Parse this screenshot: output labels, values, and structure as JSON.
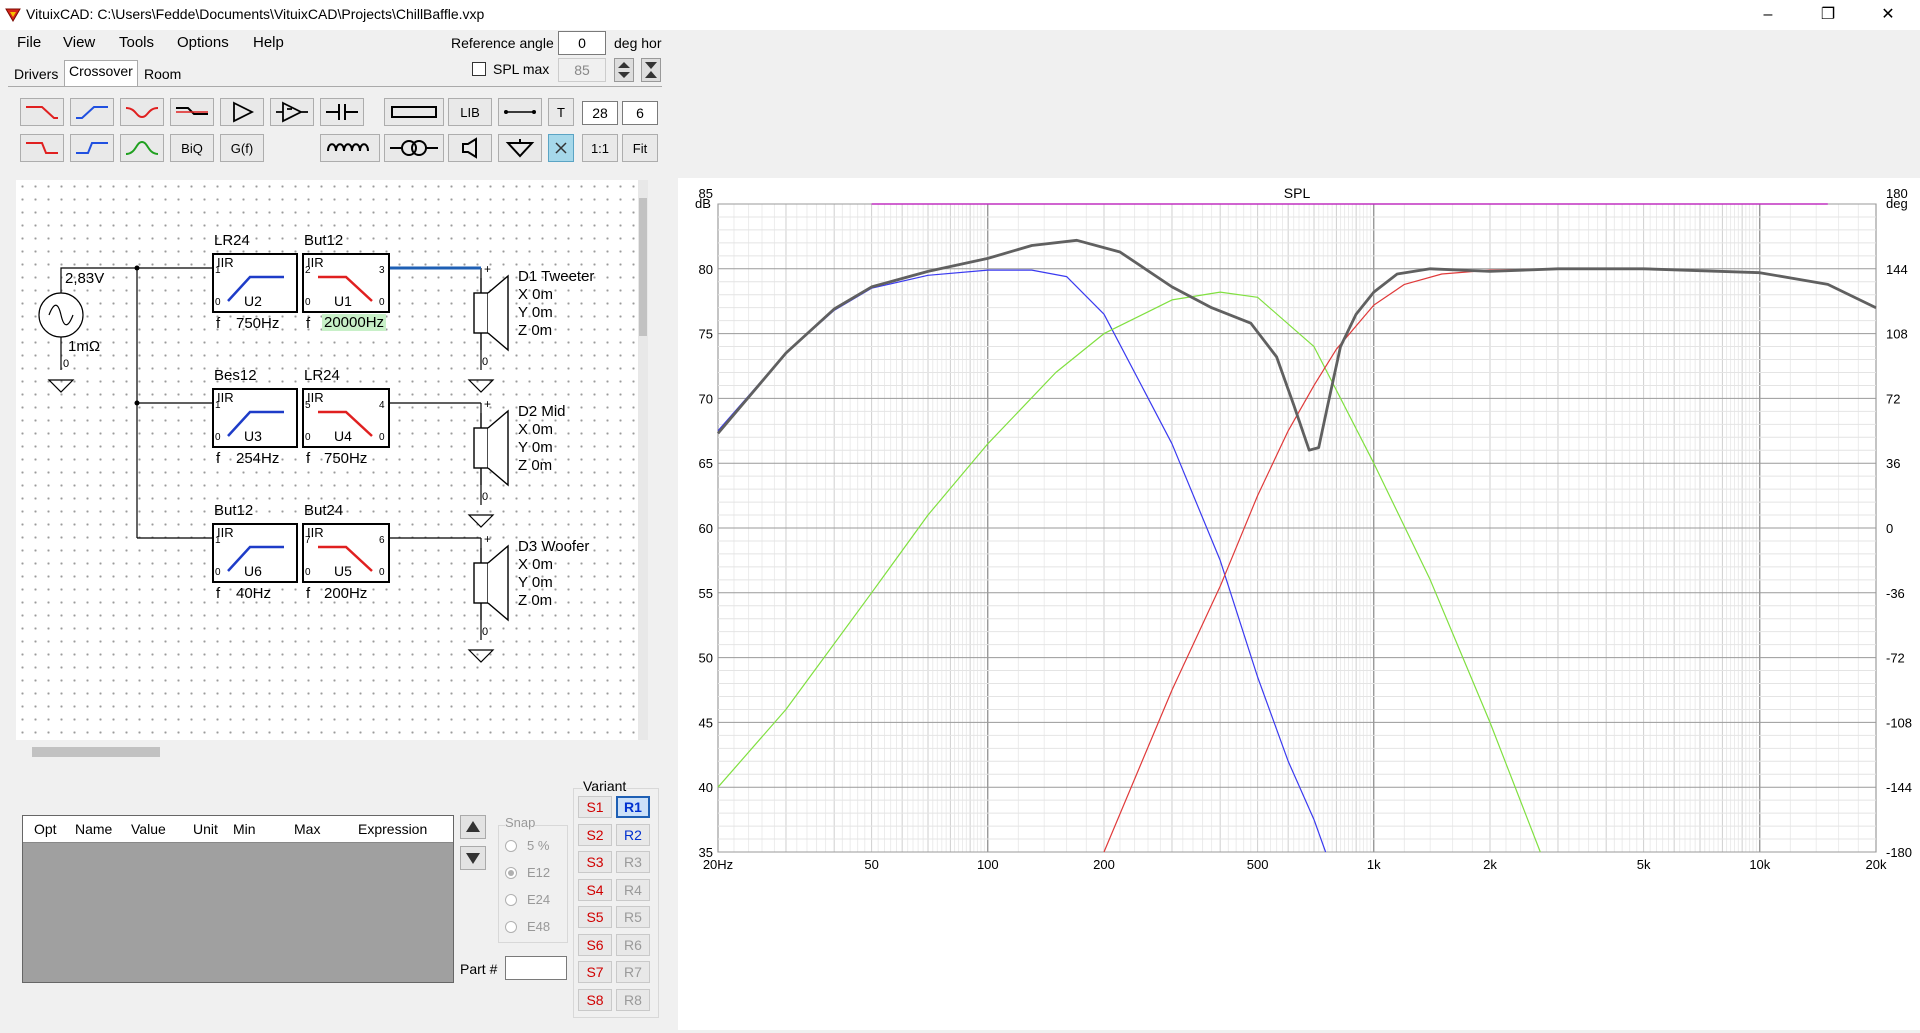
{
  "titlebar": {
    "title": "VituixCAD: C:\\Users\\Fedde\\Documents\\VituixCAD\\Projects\\ChillBaffle.vxp",
    "minimize": "–",
    "restore": "❐",
    "close": "✕"
  },
  "menu": [
    {
      "label": "File"
    },
    {
      "label": "View"
    },
    {
      "label": "Tools"
    },
    {
      "label": "Options"
    },
    {
      "label": "Help"
    }
  ],
  "reference": {
    "label": "Reference angle",
    "value": "0",
    "unit": "deg hor"
  },
  "splmax": {
    "label": "SPL max",
    "value": "85",
    "checked": false
  },
  "tabs": [
    {
      "label": "Drivers"
    },
    {
      "label": "Crossover"
    },
    {
      "label": "Room"
    }
  ],
  "toolbar": {
    "lib": "LIB",
    "t": "T",
    "one_to_one": "1:1",
    "fit": "Fit",
    "biq": "BiQ",
    "gf": "G(f)",
    "value1": "28",
    "value2": "6"
  },
  "schematic": {
    "source": {
      "voltage": "2,83V",
      "resistance": "1mΩ",
      "node": "0"
    },
    "blocks": [
      {
        "id": "U2",
        "type": "LR24",
        "kind": "IIR",
        "freq": "750Hz",
        "in": "1",
        "gnd": "0"
      },
      {
        "id": "U1",
        "type": "But12",
        "kind": "IIR",
        "freq": "20000Hz",
        "in": "2",
        "out": "3",
        "gnd": "0",
        "highlight": true
      },
      {
        "id": "U3",
        "type": "Bes12",
        "kind": "IIR",
        "freq": "254Hz",
        "in": "1",
        "gnd": "0"
      },
      {
        "id": "U4",
        "type": "LR24",
        "kind": "IIR",
        "freq": "750Hz",
        "in": "5",
        "out": "4",
        "gnd": "0"
      },
      {
        "id": "U6",
        "type": "But12",
        "kind": "IIR",
        "freq": "40Hz",
        "in": "1",
        "gnd": "0"
      },
      {
        "id": "U5",
        "type": "But24",
        "kind": "IIR",
        "freq": "200Hz",
        "in": "7",
        "out": "6",
        "gnd": "0"
      }
    ],
    "drivers": [
      {
        "name": "D1 Tweeter",
        "x": "X 0m",
        "y": "Y 0m",
        "z": "Z 0m",
        "plus": "+",
        "gnd": "0"
      },
      {
        "name": "D2 Mid",
        "x": "X 0m",
        "y": "Y 0m",
        "z": "Z 0m",
        "plus": "+",
        "gnd": "0"
      },
      {
        "name": "D3 Woofer",
        "x": "X 0m",
        "y": "Y 0m",
        "z": "Z 0m",
        "plus": "+",
        "gnd": "0"
      }
    ],
    "f_prefix": "f"
  },
  "table": {
    "columns": [
      "Opt",
      "Name",
      "Value",
      "Unit",
      "Min",
      "Max",
      "Expression"
    ]
  },
  "snap": {
    "title": "Snap",
    "options": [
      {
        "label": "5 %",
        "checked": false
      },
      {
        "label": "E12",
        "checked": true
      },
      {
        "label": "E24",
        "checked": false
      },
      {
        "label": "E48",
        "checked": false
      }
    ]
  },
  "partno": {
    "label": "Part #",
    "value": ""
  },
  "variant": {
    "title": "Variant",
    "s": [
      "S1",
      "S2",
      "S3",
      "S4",
      "S5",
      "S6",
      "S7",
      "S8"
    ],
    "r": [
      "R1",
      "R2",
      "R3",
      "R4",
      "R5",
      "R6",
      "R7",
      "R8"
    ],
    "selected": "R1"
  },
  "colors": {
    "accent": "#1e5fb4",
    "tweeter": "#e03a3a",
    "mid": "#80e040",
    "woofer": "#3a3af0",
    "sum": "#606060",
    "max": "#c030c0"
  },
  "chart_data": {
    "type": "line",
    "title": "SPL",
    "xscale": "log",
    "xlim": [
      20,
      20000
    ],
    "ylim": [
      35,
      85
    ],
    "y2lim": [
      -180,
      180
    ],
    "ylabel": "dB",
    "y2label": "deg",
    "xticks": [
      {
        "v": 20,
        "t": "20Hz"
      },
      {
        "v": 50,
        "t": "50"
      },
      {
        "v": 100,
        "t": "100"
      },
      {
        "v": 200,
        "t": "200"
      },
      {
        "v": 500,
        "t": "500"
      },
      {
        "v": 1000,
        "t": "1k"
      },
      {
        "v": 2000,
        "t": "2k"
      },
      {
        "v": 5000,
        "t": "5k"
      },
      {
        "v": 10000,
        "t": "10k"
      },
      {
        "v": 20000,
        "t": "20k"
      }
    ],
    "yticks": [
      35,
      40,
      45,
      50,
      55,
      60,
      65,
      70,
      75,
      80,
      85
    ],
    "y2ticks": [
      -180,
      -144,
      -108,
      -72,
      -36,
      0,
      36,
      72,
      108,
      144,
      180
    ],
    "grid": true,
    "series": [
      {
        "color": "#c030c0",
        "width": 1.5,
        "x": [
          50,
          15000
        ],
        "y": [
          85,
          85
        ]
      },
      {
        "color": "#3a3af0",
        "width": 1.2,
        "x": [
          20,
          30,
          40,
          50,
          70,
          100,
          130,
          160,
          200,
          250,
          300,
          400,
          500,
          600,
          700,
          750
        ],
        "y": [
          67.5,
          73.5,
          76.8,
          78.5,
          79.5,
          79.9,
          79.9,
          79.4,
          76.5,
          71,
          66.5,
          57.5,
          48.5,
          42,
          37.5,
          35
        ]
      },
      {
        "color": "#80e040",
        "width": 1.2,
        "x": [
          20,
          30,
          50,
          70,
          100,
          150,
          200,
          300,
          400,
          500,
          700,
          1000,
          1400,
          2000,
          2700
        ],
        "y": [
          40,
          46,
          55,
          61,
          66.5,
          72,
          75,
          77.6,
          78.2,
          77.8,
          74,
          65,
          56,
          45,
          35
        ]
      },
      {
        "color": "#e03a3a",
        "width": 1.2,
        "x": [
          200,
          300,
          400,
          500,
          600,
          700,
          800,
          1000,
          1200,
          1500,
          2000,
          3000,
          5000,
          10000,
          15000,
          20000
        ],
        "y": [
          35,
          47.5,
          55.5,
          62.5,
          67.5,
          71,
          73.8,
          77.2,
          78.8,
          79.6,
          79.9,
          80,
          80,
          79.7,
          78.8,
          77
        ]
      },
      {
        "color": "#606060",
        "width": 2.8,
        "x": [
          20,
          30,
          40,
          50,
          70,
          100,
          130,
          170,
          220,
          300,
          380,
          480,
          560,
          620,
          680,
          720,
          760,
          820,
          900,
          1000,
          1150,
          1400,
          2000,
          3000,
          5000,
          10000,
          15000,
          20000
        ],
        "y": [
          67.3,
          73.5,
          76.9,
          78.6,
          79.8,
          80.8,
          81.8,
          82.2,
          81.3,
          78.6,
          77,
          75.8,
          73.2,
          69.5,
          66,
          66.2,
          69.5,
          74,
          76.5,
          78.2,
          79.6,
          80,
          79.8,
          80,
          80,
          79.7,
          78.8,
          77
        ]
      }
    ]
  }
}
